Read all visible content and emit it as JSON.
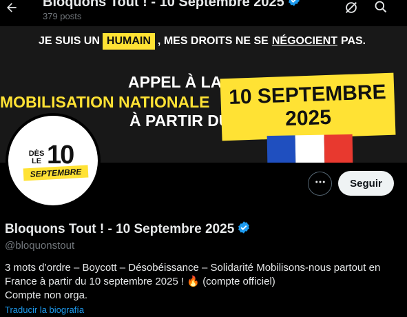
{
  "header": {
    "title": "Bloquons Tout ! - 10 Septembre 2025",
    "posts": "379 posts"
  },
  "banner": {
    "line1_before": "JE SUIS UN",
    "line1_highlight": "HUMAIN",
    "line1_mid": ", MES DROITS NE SE",
    "line1_underline": "NÉGOCIENT",
    "line1_end": "PAS.",
    "appel": "APPEL À LA",
    "mobilisation": "MOBILISATION NATIONALE",
    "partir": "À PARTIR DU",
    "date_line1": "10 SEPTEMBRE",
    "date_line2": "2025",
    "flag_colors": [
      "#1f4fbf",
      "#ffffff",
      "#e8392f"
    ]
  },
  "avatar": {
    "des": "DÈS",
    "le": "LE",
    "number": "10",
    "month": "SEPTEMBRE"
  },
  "actions": {
    "follow_label": "Seguir"
  },
  "profile": {
    "name": "Bloquons Tout ! - 10 Septembre 2025",
    "handle": "@bloquonstout",
    "bio_line1": "3 mots d’ordre – Boycott – Désobéissance – Solidarité Mobilisons-nous partout en",
    "bio_line2_text": "France à partir du 10 septembre 2025 !",
    "bio_line2_emoji": "🔥",
    "bio_line2_end": "(compte officiel)",
    "bio_line3": "Compte non orga.",
    "translate_label": "Traducir la biografía"
  },
  "colors": {
    "accent": "#1d9bf0",
    "banner_yellow": "#ffe234"
  }
}
